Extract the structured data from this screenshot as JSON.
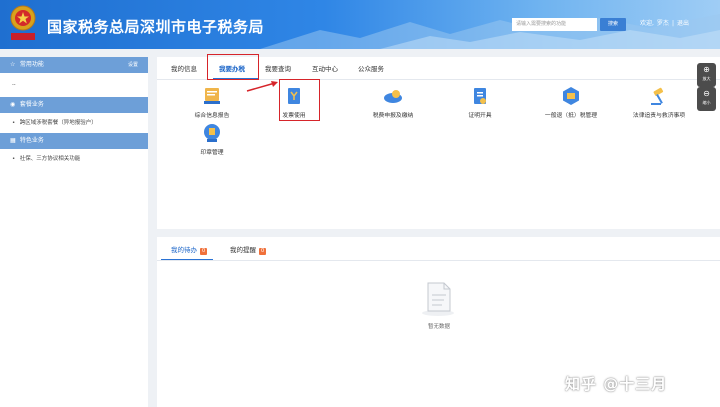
{
  "header": {
    "title": "国家税务总局深圳市电子税务局",
    "logo_text": "中国税务",
    "search_placeholder": "请输入需要搜索的功能",
    "search_button": "搜索",
    "welcome": "欢迎,",
    "user": "罗杰",
    "logout": "退出"
  },
  "sidebar": {
    "sections": [
      {
        "icon": "star-icon",
        "title": "常用功能",
        "action": "设置",
        "sub": "--"
      },
      {
        "icon": "package-icon",
        "title": "套餐业务",
        "items": [
          "跨区域涉税套餐（异地报验户）"
        ]
      },
      {
        "icon": "grid-icon",
        "title": "特色业务",
        "items": [
          "社保、三方协议相关功能"
        ]
      }
    ]
  },
  "main_tabs": [
    "我的信息",
    "我要办税",
    "我要查询",
    "互动中心",
    "公众服务"
  ],
  "active_tab": "我要办税",
  "functions": [
    {
      "label": "综合信息报告",
      "icon": "report-icon"
    },
    {
      "label": "发票使用",
      "icon": "invoice-icon"
    },
    {
      "label": "税费申报及缴纳",
      "icon": "cloud-tax-icon"
    },
    {
      "label": "证明开具",
      "icon": "certificate-icon"
    },
    {
      "label": "一般退（抵）税管理",
      "icon": "refund-icon"
    },
    {
      "label": "法律追责与救济事项",
      "icon": "gavel-icon"
    },
    {
      "label": "印章管理",
      "icon": "seal-icon"
    }
  ],
  "bottom_tabs": [
    {
      "label": "我的待办",
      "count": "0"
    },
    {
      "label": "我的提醒",
      "count": "0"
    }
  ],
  "empty_text": "暂无数据",
  "zoom": {
    "in": "放大",
    "out": "缩小"
  },
  "watermark": "知乎 @十三月",
  "colors": {
    "header_blue": "#2f86e6",
    "sidebar_head": "#6d9fd8",
    "highlight_red": "#d6242a",
    "badge_orange": "#f0703a"
  }
}
